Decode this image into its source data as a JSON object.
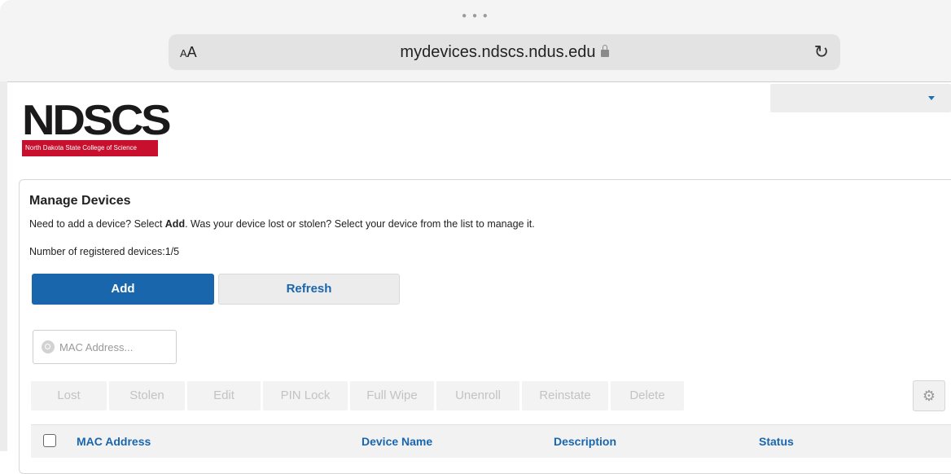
{
  "browser": {
    "text_size_label_small": "A",
    "text_size_label_large": "A",
    "url": "mydevices.ndscs.ndus.edu"
  },
  "header": {
    "logo_text": "NDSCS",
    "logo_subtitle": "North Dakota State College of Science",
    "user_dropdown_value": ""
  },
  "page": {
    "title": "Manage Devices",
    "desc_pre": "Need to add a device? Select ",
    "desc_bold": "Add",
    "desc_post": ". Was your device lost or stolen? Select your device from the list to manage it.",
    "count_text": "Number of registered devices:1/5"
  },
  "buttons": {
    "add": "Add",
    "refresh": "Refresh"
  },
  "search": {
    "placeholder": "MAC Address...",
    "value": ""
  },
  "actions": [
    "Lost",
    "Stolen",
    "Edit",
    "PIN Lock",
    "Full Wipe",
    "Unenroll",
    "Reinstate",
    "Delete"
  ],
  "table": {
    "columns": [
      "MAC Address",
      "Device Name",
      "Description",
      "Status"
    ]
  },
  "colors": {
    "primary": "#1a66ad",
    "logo_red": "#c8102e",
    "disabled_text": "#c3c3c3"
  }
}
